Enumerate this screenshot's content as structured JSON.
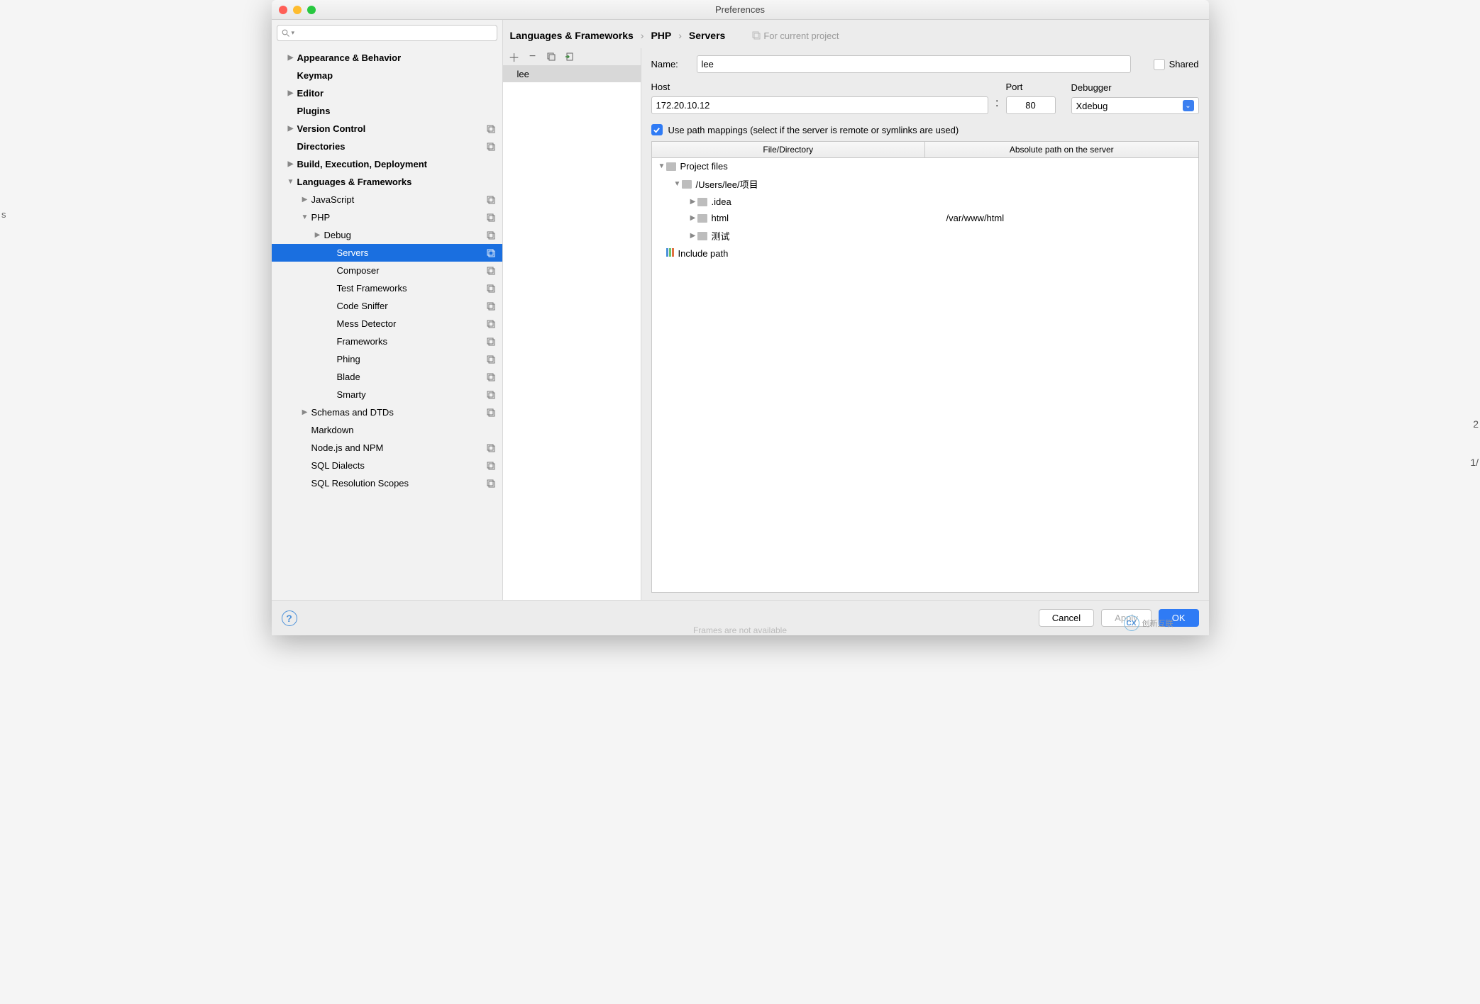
{
  "window": {
    "title": "Preferences"
  },
  "breadcrumb": {
    "a": "Languages & Frameworks",
    "b": "PHP",
    "c": "Servers",
    "for_project": "For current project"
  },
  "sidebar": {
    "items": [
      {
        "label": "Appearance & Behavior",
        "bold": true,
        "arrow": "▶",
        "indent": 1
      },
      {
        "label": "Keymap",
        "bold": true,
        "indent": 1
      },
      {
        "label": "Editor",
        "bold": true,
        "arrow": "▶",
        "indent": 1
      },
      {
        "label": "Plugins",
        "bold": true,
        "indent": 1
      },
      {
        "label": "Version Control",
        "bold": true,
        "arrow": "▶",
        "indent": 1,
        "copy": true
      },
      {
        "label": "Directories",
        "bold": true,
        "indent": 1,
        "copy": true
      },
      {
        "label": "Build, Execution, Deployment",
        "bold": true,
        "arrow": "▶",
        "indent": 1
      },
      {
        "label": "Languages & Frameworks",
        "bold": true,
        "arrow": "▼",
        "indent": 1
      },
      {
        "label": "JavaScript",
        "arrow": "▶",
        "indent": 2,
        "copy": true
      },
      {
        "label": "PHP",
        "arrow": "▼",
        "indent": 2,
        "copy": true
      },
      {
        "label": "Debug",
        "arrow": "▶",
        "indent": 3,
        "copy": true
      },
      {
        "label": "Servers",
        "indent": 4,
        "copy": true,
        "selected": true
      },
      {
        "label": "Composer",
        "indent": 4,
        "copy": true
      },
      {
        "label": "Test Frameworks",
        "indent": 4,
        "copy": true
      },
      {
        "label": "Code Sniffer",
        "indent": 4,
        "copy": true
      },
      {
        "label": "Mess Detector",
        "indent": 4,
        "copy": true
      },
      {
        "label": "Frameworks",
        "indent": 4,
        "copy": true
      },
      {
        "label": "Phing",
        "indent": 4,
        "copy": true
      },
      {
        "label": "Blade",
        "indent": 4,
        "copy": true
      },
      {
        "label": "Smarty",
        "indent": 4,
        "copy": true
      },
      {
        "label": "Schemas and DTDs",
        "arrow": "▶",
        "indent": 2,
        "copy": true
      },
      {
        "label": "Markdown",
        "indent": 2
      },
      {
        "label": "Node.js and NPM",
        "indent": 2,
        "copy": true
      },
      {
        "label": "SQL Dialects",
        "indent": 2,
        "copy": true
      },
      {
        "label": "SQL Resolution Scopes",
        "indent": 2,
        "copy": true
      }
    ]
  },
  "servers_list": {
    "selected": "lee"
  },
  "form": {
    "name_label": "Name:",
    "name_value": "lee",
    "shared_label": "Shared",
    "host_label": "Host",
    "host_value": "172.20.10.12",
    "port_label": "Port",
    "port_value": "80",
    "debugger_label": "Debugger",
    "debugger_value": "Xdebug",
    "use_path_mappings": "Use path mappings (select if the server is remote or symlinks are used)",
    "th1": "File/Directory",
    "th2": "Absolute path on the server",
    "tree": [
      {
        "indent": 0,
        "arrow": "▼",
        "label": "Project files",
        "abs": ""
      },
      {
        "indent": 1,
        "arrow": "▼",
        "label": "/Users/lee/项目",
        "abs": ""
      },
      {
        "indent": 2,
        "arrow": "▶",
        "label": ".idea",
        "abs": ""
      },
      {
        "indent": 2,
        "arrow": "▶",
        "label": "html",
        "abs": "/var/www/html"
      },
      {
        "indent": 2,
        "arrow": "▶",
        "label": "测试",
        "abs": ""
      },
      {
        "indent": 0,
        "arrow": "",
        "label": "Include path",
        "abs": "",
        "colorful": true
      }
    ]
  },
  "footer": {
    "cancel": "Cancel",
    "apply": "Apply",
    "ok": "OK"
  },
  "misc": {
    "frames": "Frames are not available",
    "watermark": "创新互联",
    "edge2": "2",
    "edge1": "1/",
    "edgeS": "s"
  }
}
